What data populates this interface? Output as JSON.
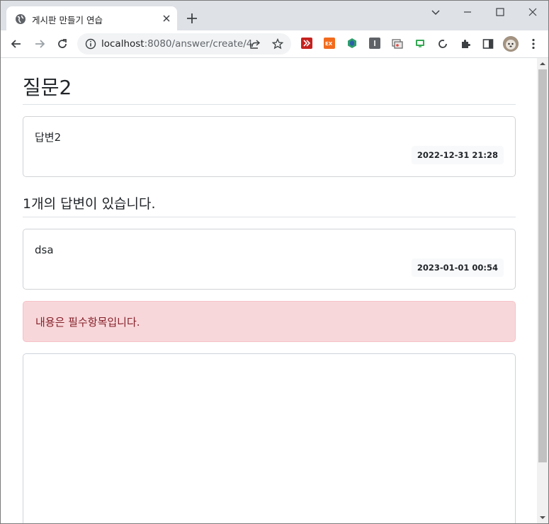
{
  "browser": {
    "tab_title": "게시판 만들기 연습",
    "url_host": "localhost",
    "url_path": ":8080/answer/create/4"
  },
  "question": {
    "title": "질문2",
    "content": "답변2",
    "created": "2022-12-31 21:28"
  },
  "answers": {
    "count_text": "1개의 답변이 있습니다.",
    "items": [
      {
        "content": "dsa",
        "created": "2023-01-01 00:54"
      }
    ]
  },
  "error": {
    "message": "내용은 필수항목입니다."
  },
  "answer_form": {
    "content_value": ""
  }
}
